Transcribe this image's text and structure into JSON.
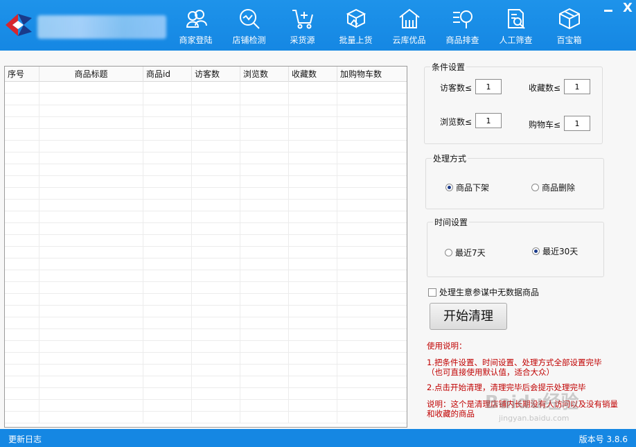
{
  "header": {
    "nav": [
      {
        "label": "商家登陆",
        "icon": "merchant-login-icon"
      },
      {
        "label": "店铺检测",
        "icon": "store-check-icon"
      },
      {
        "label": "采货源",
        "icon": "source-goods-icon"
      },
      {
        "label": "批量上货",
        "icon": "bulk-upload-icon"
      },
      {
        "label": "云库优品",
        "icon": "cloud-warehouse-icon"
      },
      {
        "label": "商品排查",
        "icon": "product-inspect-icon"
      },
      {
        "label": "人工筛查",
        "icon": "manual-screen-icon"
      },
      {
        "label": "百宝箱",
        "icon": "toolbox-icon"
      }
    ],
    "close_label": "X"
  },
  "table": {
    "columns": [
      "序号",
      "商品标题",
      "商品id",
      "访客数",
      "浏览数",
      "收藏数",
      "加购物车数"
    ],
    "rows": []
  },
  "conditions": {
    "legend": "条件设置",
    "visitors_label": "访客数≤",
    "visitors_value": "1",
    "favorites_label": "收藏数≤",
    "favorites_value": "1",
    "views_label": "浏览数≤",
    "views_value": "1",
    "cart_label": "购物车≤",
    "cart_value": "1"
  },
  "method": {
    "legend": "处理方式",
    "options": [
      {
        "label": "商品下架",
        "selected": true
      },
      {
        "label": "商品删除",
        "selected": false
      }
    ]
  },
  "time": {
    "legend": "时间设置",
    "options": [
      {
        "label": "最近7天",
        "selected": false
      },
      {
        "label": "最近30天",
        "selected": true
      }
    ]
  },
  "checkbox": {
    "label": "处理生意参谋中无数据商品",
    "checked": false
  },
  "start_button": "开始清理",
  "usage": {
    "title": "使用说明：",
    "line1": "1.把条件设置、时间设置、处理方式全部设置完毕（也可直接使用默认值，适合大众）",
    "line2": "2.点击开始清理，清理完毕后会提示处理完毕",
    "line3": "说明：这个是清理店铺内长期没有人访问以及没有销量和收藏的商品"
  },
  "watermark": {
    "text": "Baidu经验",
    "sub": "jingyan.baidu.com"
  },
  "footer": {
    "update_log": "更新日志",
    "version": "版本号 3.8.6"
  },
  "colors": {
    "header": "#1587e3",
    "accent_text": "#c00000"
  }
}
